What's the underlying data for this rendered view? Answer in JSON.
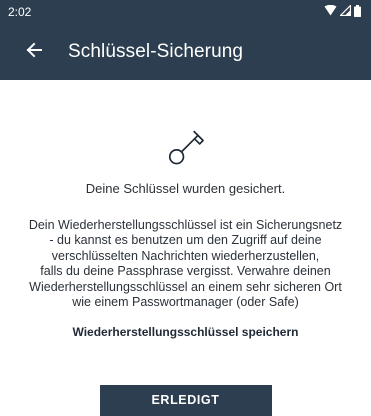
{
  "status_bar": {
    "time": "2:02",
    "icons": [
      "wifi-icon",
      "cell-signal-icon",
      "battery-icon"
    ]
  },
  "app_bar": {
    "back_icon": "arrow-left-icon",
    "title": "Schlüssel-Sicherung"
  },
  "main": {
    "icon": "key-icon",
    "saved_message": "Deine Schlüssel wurden gesichert.",
    "description_lines": [
      "Dein Wiederherstellungsschlüssel ist ein Sicherungsnetz",
      "- du kannst es benutzen um den Zugriff auf deine",
      "verschlüsselten Nachrichten wiederherzustellen,",
      "falls du deine Passphrase vergisst. Verwahre deinen",
      "Wiederherstellungsschlüssel an einem sehr sicheren Ort",
      "wie einem Passwortmanager (oder Safe)"
    ],
    "save_key_link": "Wiederherstellungsschlüssel speichern",
    "done_button": "ERLEDIGT"
  },
  "colors": {
    "primary": "#2c3e50",
    "background": "#ffffff",
    "text": "#2b3138"
  }
}
